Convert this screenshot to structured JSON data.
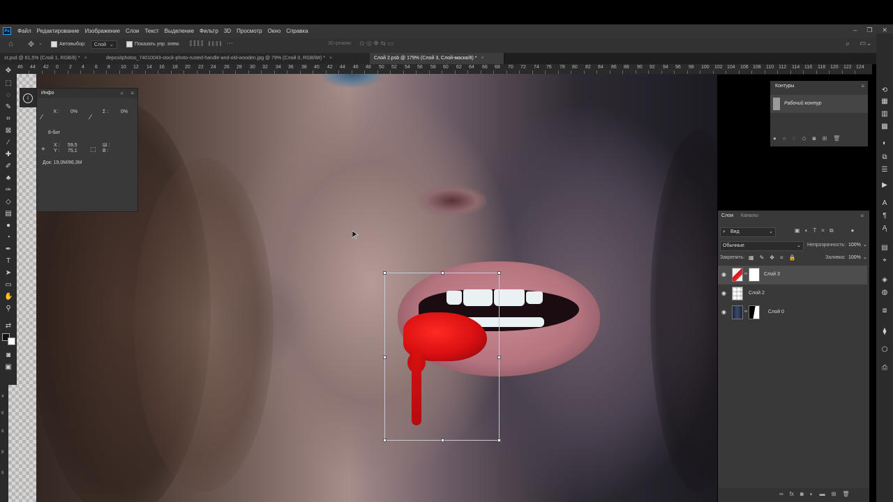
{
  "app": {
    "logo": "Ps"
  },
  "menu": [
    "Файл",
    "Редактирование",
    "Изображение",
    "Слои",
    "Текст",
    "Выделение",
    "Фильтр",
    "3D",
    "Просмотр",
    "Окно",
    "Справка"
  ],
  "options": {
    "autoselect_label": "Автовыбор:",
    "autoselect_value": "Слой",
    "show_controls_label": "Показать упр. элем.",
    "mode_3d": "3D-режим:"
  },
  "tabs": [
    {
      "label": "st.psd @ 61,5% (Слой 1, RGB/8) *"
    },
    {
      "label": "depositphotos_74010043-stock-photo-rusted-handle-and-old-wooden.jpg @ 79% (Слой 0, RGB/8#) *"
    },
    {
      "label": "Слой 2.psb @ 179% (Слой 3, Слой-маска/8) *"
    }
  ],
  "ruler": [
    "48",
    "46",
    "44",
    "42",
    "0",
    "2",
    "4",
    "6",
    "8",
    "10",
    "12",
    "14",
    "16",
    "18",
    "20",
    "22",
    "24",
    "26",
    "28",
    "30",
    "32",
    "34",
    "36",
    "38",
    "40",
    "42",
    "44",
    "46",
    "48",
    "50",
    "52",
    "54",
    "56",
    "58",
    "60",
    "62",
    "64",
    "66",
    "68",
    "70",
    "72",
    "74",
    "76",
    "78",
    "80",
    "82",
    "84",
    "86",
    "88",
    "90",
    "92",
    "94",
    "96",
    "98",
    "100",
    "102",
    "104",
    "106",
    "108",
    "110",
    "112",
    "114",
    "116",
    "118",
    "120",
    "122",
    "124"
  ],
  "vruler": [
    "4",
    "6",
    "8",
    "8",
    "9"
  ],
  "info_panel": {
    "title": "Инфо",
    "k_label": "К :",
    "k_value": "0%",
    "sigma_label": "Σ :",
    "sigma_value": "0%",
    "bits": "8-бит",
    "x_label": "X :",
    "x_value": "59,5",
    "y_label": "Y :",
    "y_value": "75,1",
    "w_label": "Ш :",
    "h_label": "В :",
    "doc": "Док: 19,0M/86,3M"
  },
  "paths_panel": {
    "title": "Контуры",
    "item": "Рабочий контур"
  },
  "layers_panel": {
    "tab_layers": "Слои",
    "tab_channels": "Каналы",
    "filter_label": "Вид",
    "blend_mode": "Обычные",
    "opacity_label": "Непрозрачность:",
    "opacity_value": "100%",
    "lock_label": "Закрепить:",
    "fill_label": "Заливка:",
    "fill_value": "100%",
    "layers": [
      {
        "name": "Слой 3"
      },
      {
        "name": "Слой 2"
      },
      {
        "name": "Слой 0"
      }
    ]
  }
}
